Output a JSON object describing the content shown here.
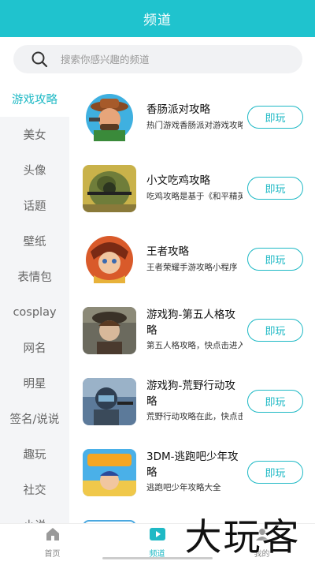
{
  "header": {
    "title": "频道"
  },
  "search": {
    "placeholder": "搜索你感兴趣的频道"
  },
  "sidebar": {
    "items": [
      {
        "label": "游戏攻略",
        "active": true
      },
      {
        "label": "美女"
      },
      {
        "label": "头像"
      },
      {
        "label": "话题"
      },
      {
        "label": "壁纸"
      },
      {
        "label": "表情包"
      },
      {
        "label": "cosplay"
      },
      {
        "label": "网名"
      },
      {
        "label": "明星"
      },
      {
        "label": "签名/说说"
      },
      {
        "label": "趣玩"
      },
      {
        "label": "社交"
      },
      {
        "label": "小说"
      }
    ]
  },
  "list": {
    "button_label": "即玩",
    "items": [
      {
        "title": "香肠派对攻略",
        "desc": "热门游戏香肠派对游戏攻略"
      },
      {
        "title": "小文吃鸡攻略",
        "desc": "吃鸡攻略是基于《和平精英》"
      },
      {
        "title": "王者攻略",
        "desc": "王者荣耀手游攻略小程序"
      },
      {
        "title": "游戏狗-第五人格攻略",
        "desc": "第五人格攻略，快点击进入"
      },
      {
        "title": "游戏狗-荒野行动攻略",
        "desc": "荒野行动攻略在此，快点击"
      },
      {
        "title": "3DM-逃跑吧少年攻略",
        "desc": "逃跑吧少年攻略大全"
      }
    ]
  },
  "tabbar": {
    "items": [
      {
        "label": "首页",
        "icon": "home-icon"
      },
      {
        "label": "频道",
        "icon": "play-icon",
        "active": true
      },
      {
        "label": "我的",
        "icon": "user-icon"
      }
    ]
  },
  "watermark": {
    "text": "大玩客"
  },
  "colors": {
    "accent": "#1fc3ce",
    "accent_text": "#1fb9c5"
  }
}
